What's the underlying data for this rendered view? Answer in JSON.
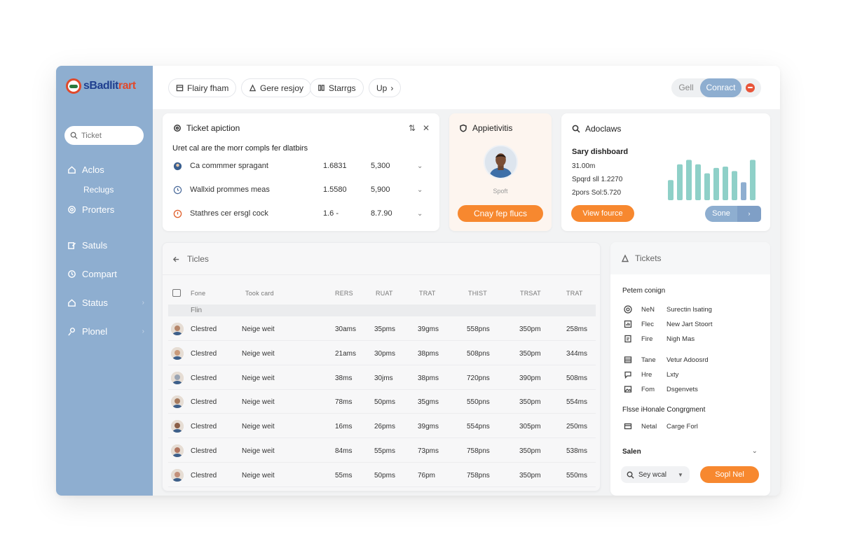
{
  "brand": {
    "logo_text_a": "sBadlit",
    "logo_text_b": "rart"
  },
  "sidebar": {
    "search_placeholder": "Ticket",
    "items": [
      {
        "label": "Aclos",
        "icon": "home-icon"
      },
      {
        "label": "Reclugs",
        "icon": ""
      },
      {
        "label": "Prorters",
        "icon": "gear-icon"
      },
      {
        "label": "Satuls",
        "icon": "edit-icon"
      },
      {
        "label": "Compart",
        "icon": "clock-icon"
      },
      {
        "label": "Status",
        "icon": "home-icon"
      },
      {
        "label": "Plonel",
        "icon": "user-icon"
      }
    ]
  },
  "topbar": {
    "pills": [
      "Flairy fham",
      "Gere resjoy",
      "Starrgs",
      "Up"
    ],
    "toggle_off": "Gell",
    "toggle_on": "Conract"
  },
  "ticket_card": {
    "title": "Ticket apiction",
    "subtitle": "Uret cal are the morr compls fer dlatbirs",
    "rows": [
      {
        "label": "Ca commmer spragant",
        "v1": "1.6831",
        "v2": "5,300"
      },
      {
        "label": "Wallxid prommes meas",
        "v1": "1.5580",
        "v2": "5,900"
      },
      {
        "label": "Stathres cer ersgl cock",
        "v1": "1.6 -",
        "v2": "8.7.90"
      }
    ]
  },
  "profile_card": {
    "title": "Appietivitis",
    "caption": "Spoft",
    "button": "Cnay fep flucs"
  },
  "analytics_card": {
    "title": "Adoclaws",
    "heading": "Sary dishboard",
    "lines": [
      "31.00m",
      "Spqrd sll 1.2270",
      "2pors Sol:5.720"
    ],
    "button": "View fource",
    "seg_a": "Sone",
    "seg_b": "›",
    "bars": [
      0.45,
      0.8,
      0.9,
      0.8,
      0.6,
      0.72,
      0.75,
      0.65,
      0.4,
      0.9
    ],
    "bar_colors": [
      "#8fd0c8",
      "#8fd0c8",
      "#8fd0c8",
      "#8fd0c8",
      "#8fd0c8",
      "#8fd0c8",
      "#8fd0c8",
      "#8fd0c8",
      "#8eaed0",
      "#8fd0c8"
    ]
  },
  "table": {
    "title": "Ticles",
    "headers": [
      "Fone",
      "Took card",
      "RERS",
      "RUAT",
      "TRAT",
      "THIST",
      "TRSAT",
      "TRAT"
    ],
    "group": "Flin",
    "rows": [
      {
        "status": "Clestred",
        "name": "Neige weit",
        "c1": "30ams",
        "c2": "35pms",
        "c3": "39gms",
        "c4": "558pns",
        "c5": "350pm",
        "c6": "258ms"
      },
      {
        "status": "Clestred",
        "name": "Neige weit",
        "c1": "21ams",
        "c2": "30pms",
        "c3": "38pms",
        "c4": "508pns",
        "c5": "350pm",
        "c6": "344ms"
      },
      {
        "status": "Clestred",
        "name": "Neige weit",
        "c1": "38ms",
        "c2": "30jms",
        "c3": "38pms",
        "c4": "720pns",
        "c5": "390pm",
        "c6": "508ms"
      },
      {
        "status": "Clestred",
        "name": "Neige weit",
        "c1": "78ms",
        "c2": "50pms",
        "c3": "35gms",
        "c4": "550pns",
        "c5": "350pm",
        "c6": "554ms"
      },
      {
        "status": "Clestred",
        "name": "Neige weit",
        "c1": "16ms",
        "c2": "26pms",
        "c3": "39gms",
        "c4": "554pns",
        "c5": "305pm",
        "c6": "250ms"
      },
      {
        "status": "Clestred",
        "name": "Neige weit",
        "c1": "84ms",
        "c2": "55pms",
        "c3": "73pms",
        "c4": "758pns",
        "c5": "350pm",
        "c6": "538ms"
      },
      {
        "status": "Clestred",
        "name": "Neige weit",
        "c1": "55ms",
        "c2": "50pms",
        "c3": "76pm",
        "c4": "758pns",
        "c5": "350pm",
        "c6": "550ms"
      }
    ]
  },
  "right_panel": {
    "title": "Tickets",
    "section1": "Petem conign",
    "group1": [
      {
        "k": "NeN",
        "v": "Surectin lsating",
        "icon": "target-icon"
      },
      {
        "k": "Flec",
        "v": "New Jart Stoort",
        "icon": "chart-icon"
      },
      {
        "k": "Fire",
        "v": "Nigh Mas",
        "icon": "document-icon"
      }
    ],
    "group2": [
      {
        "k": "Tane",
        "v": "Vetur Adoosrd",
        "icon": "table-icon"
      },
      {
        "k": "Hre",
        "v": "Lxty",
        "icon": "message-icon"
      },
      {
        "k": "Fom",
        "v": "Dsgenvets",
        "icon": "image-icon"
      }
    ],
    "section2": "Flsse iHonale Congrgment",
    "group3": [
      {
        "k": "Netal",
        "v": "Carge Forl",
        "icon": "card-icon"
      }
    ],
    "select_label": "Salen",
    "select_value": "Sey wcal",
    "button": "Sopl Nel"
  }
}
